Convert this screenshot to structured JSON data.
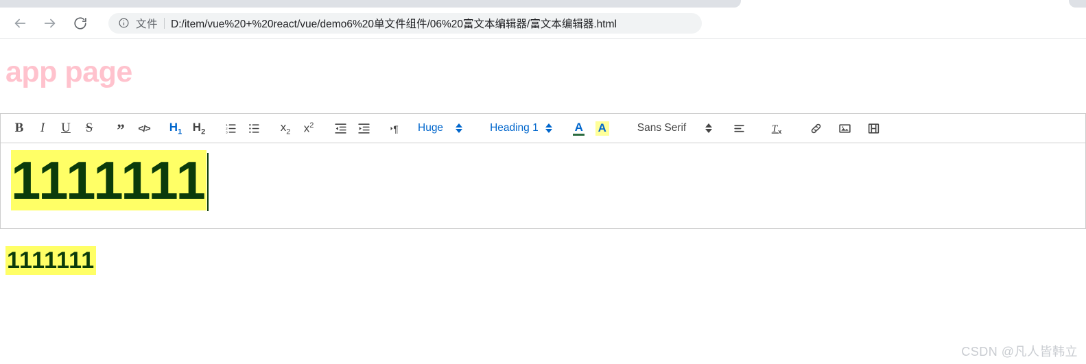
{
  "browser": {
    "nav": {
      "back_icon": "arrow-left-icon",
      "forward_icon": "arrow-right-icon",
      "reload_icon": "reload-icon"
    },
    "omnibox": {
      "info_icon": "info-circle-icon",
      "scheme_label": "文件",
      "url": "D:/item/vue%20+%20react/vue/demo6%20单文件组件/06%20富文本编辑器/富文本编辑器.html"
    }
  },
  "page": {
    "title": "app page",
    "title_color": "#ffc2cd"
  },
  "editor": {
    "toolbar": {
      "groups": [
        {
          "items": [
            {
              "name": "bold-button",
              "label": "B",
              "icon": "bold-icon",
              "active": false
            },
            {
              "name": "italic-button",
              "label": "I",
              "icon": "italic-icon",
              "active": false
            },
            {
              "name": "underline-button",
              "label": "U",
              "icon": "underline-icon",
              "active": false
            },
            {
              "name": "strike-button",
              "label": "S",
              "icon": "strikethrough-icon",
              "active": false
            }
          ]
        },
        {
          "items": [
            {
              "name": "blockquote-button",
              "label": "”",
              "icon": "blockquote-icon",
              "active": false
            },
            {
              "name": "code-block-button",
              "label": "</>",
              "icon": "code-icon",
              "active": false
            }
          ]
        },
        {
          "items": [
            {
              "name": "header-1-button",
              "label": "H1",
              "icon": "heading-1-icon",
              "active": true
            },
            {
              "name": "header-2-button",
              "label": "H2",
              "icon": "heading-2-icon",
              "active": false
            }
          ]
        },
        {
          "items": [
            {
              "name": "ordered-list-button",
              "label": "",
              "icon": "ordered-list-icon",
              "active": false
            },
            {
              "name": "bullet-list-button",
              "label": "",
              "icon": "bullet-list-icon",
              "active": false
            }
          ]
        },
        {
          "items": [
            {
              "name": "subscript-button",
              "label": "x2",
              "icon": "subscript-icon",
              "active": false
            },
            {
              "name": "superscript-button",
              "label": "x2",
              "icon": "superscript-icon",
              "active": false
            }
          ]
        },
        {
          "items": [
            {
              "name": "outdent-button",
              "label": "",
              "icon": "outdent-icon",
              "active": false
            },
            {
              "name": "indent-button",
              "label": "",
              "icon": "indent-icon",
              "active": false
            }
          ]
        },
        {
          "items": [
            {
              "name": "text-direction-button",
              "label": "¶",
              "icon": "text-direction-icon",
              "active": false
            }
          ]
        }
      ],
      "size_picker": {
        "name": "size-picker",
        "value": "Huge",
        "active": true
      },
      "header_picker": {
        "name": "header-picker",
        "value": "Heading 1",
        "active": true
      },
      "text_color": {
        "name": "text-color-button",
        "glyph": "A",
        "icon": "font-color-icon",
        "bar_color": "#2b6b3f"
      },
      "background_color": {
        "name": "background-color-button",
        "glyph": "A",
        "icon": "highlight-color-icon",
        "swatch_color": "#ffff99"
      },
      "font_picker": {
        "name": "font-picker",
        "value": "Sans Serif",
        "active": false
      },
      "align_button": {
        "name": "align-button",
        "icon": "align-icon"
      },
      "clean_button": {
        "name": "clear-format-button",
        "label": "Tx",
        "icon": "clear-format-icon"
      },
      "link_button": {
        "name": "link-button",
        "icon": "link-icon"
      },
      "image_button": {
        "name": "image-button",
        "icon": "image-icon"
      },
      "video_button": {
        "name": "video-button",
        "icon": "video-icon"
      }
    },
    "content": {
      "text": "1111111",
      "highlight_color": "#ffff66",
      "text_color": "#0b3b0b"
    },
    "preview": {
      "text": "1111111",
      "highlight_color": "#ffff66",
      "text_color": "#0b3b0b"
    }
  },
  "watermark": {
    "text": "CSDN @凡人皆韩立"
  }
}
